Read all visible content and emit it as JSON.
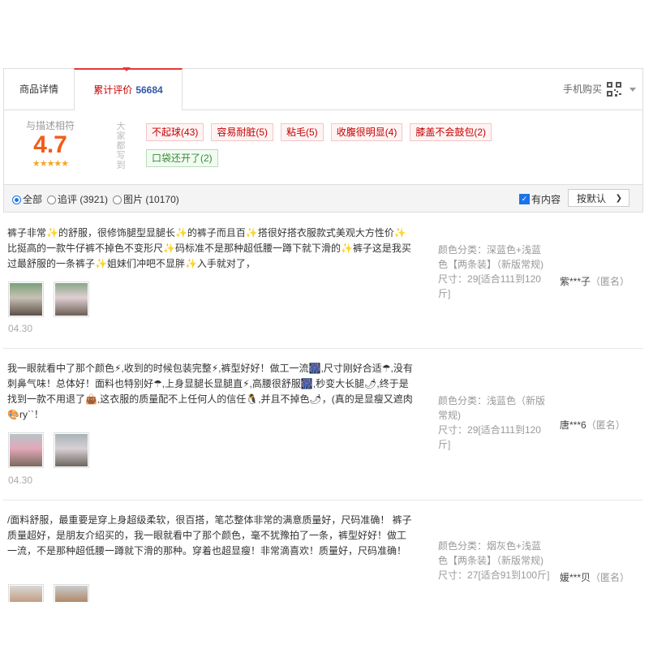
{
  "tabs": [
    {
      "label": "商品详情"
    },
    {
      "label": "累计评价",
      "count": "56684"
    }
  ],
  "mobile_buy": "手机购买",
  "rating": {
    "label": "与描述相符",
    "score": "4.7",
    "stars": "★★★★★",
    "everyone_says": "大家都写到",
    "tags": [
      {
        "text": "不起球(43)",
        "tone": "red"
      },
      {
        "text": "容易耐脏(5)",
        "tone": "red"
      },
      {
        "text": "粘毛(5)",
        "tone": "red"
      },
      {
        "text": "收腹很明显(4)",
        "tone": "red"
      },
      {
        "text": "膝盖不会鼓包(2)",
        "tone": "red"
      },
      {
        "text": "口袋还开了(2)",
        "tone": "green"
      }
    ]
  },
  "filter": {
    "all": "全部",
    "followup": "追评 (3921)",
    "images": "图片 (10170)",
    "has_content": "有内容",
    "sort": "按默认"
  },
  "reviews": [
    {
      "text": "裤子非常✨的舒服，很修饰腿型显腿长✨的裤子而且百✨搭很好搭衣服款式美观大方性价✨比挺高的一款牛仔裤不掉色不变形尺✨码标准不是那种超低腰一蹲下就下滑的✨裤子这是我买过最舒服的一条裤子✨姐妹们冲吧不显胖✨入手就对了，",
      "date": "04.30",
      "color_label": "颜色分类：",
      "color": "深蓝色+浅蓝色【两条装】（新版常规)",
      "size_label": "尺寸：",
      "size": "29[适合111到120斤]",
      "user": "紫***子",
      "anon": "（匿名）"
    },
    {
      "text": "我一眼就看中了那个颜色⚡,收到的时候包装完整⚡,裤型好好！做工一流🎆,尺寸刚好合适☂,没有刺鼻气味！总体好！面料也特别好☂,上身显腿长显腿直⚡,高腰很舒服🎆,秒变大长腿🌶,终于是找到一款不用退了👜,这衣服的质量配不上任何人的信任🐧,并且不掉色🌶，(真的是显瘦又遮肉🎨ry``！",
      "date": "04.30",
      "color_label": "颜色分类：",
      "color": "浅蓝色（新版常规)",
      "size_label": "尺寸：",
      "size": "29[适合111到120斤]",
      "user": "唐***6",
      "anon": "（匿名）"
    },
    {
      "text": "/面料舒服，最重要是穿上身超级柔软，很百搭，笔芯整体非常的满意质量好，尺码准确！ 裤子质量超好，是朋友介绍买的，我一眼就看中了那个颜色，毫不犹豫拍了一条，裤型好好！做工一流，不是那种超低腰一蹲就下滑的那种。穿着也超显瘦！非常滴喜欢！质量好，尺码准确！",
      "date": "",
      "color_label": "颜色分类：",
      "color": "烟灰色+浅蓝色【两条装】（新版常规)",
      "size_label": "尺寸：",
      "size": "27[适合91到100斤]",
      "user": "媛***贝",
      "anon": "（匿名）"
    }
  ],
  "colors": {
    "accent": "#c40000",
    "score": "#f25d19",
    "star": "#f5a623",
    "count": "#3355aa"
  }
}
